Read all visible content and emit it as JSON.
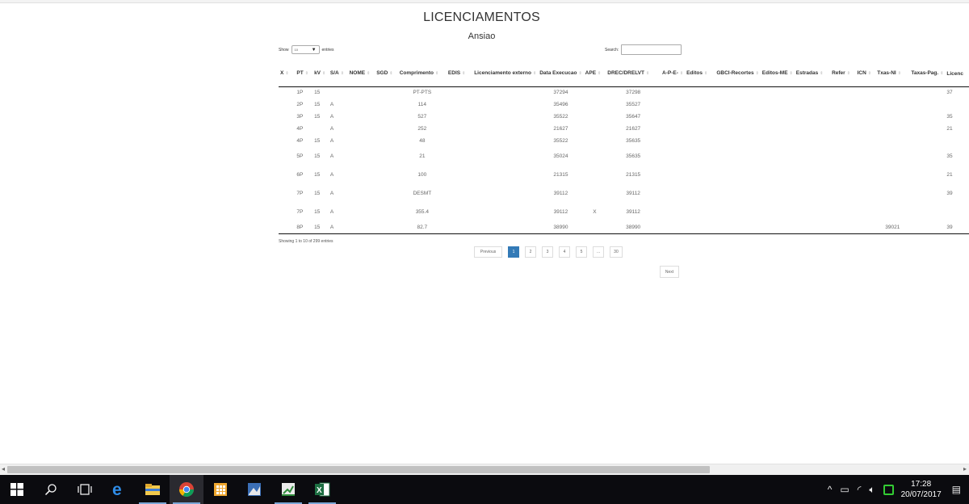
{
  "page": {
    "title": "LICENCIAMENTOS",
    "subtitle": "Ansiao"
  },
  "controls": {
    "show_label": "Show",
    "length_value": "10",
    "entries_label": "entries",
    "search_label": "Search:",
    "search_value": ""
  },
  "table": {
    "headers": [
      "X",
      "PT",
      "kV",
      "S/A",
      "NOME",
      "SGD",
      "Comprimento",
      "EDIS",
      "Licenciamento externo",
      "Data Execucao",
      "APE",
      "DREC/DRELVT",
      "A-P-E-",
      "Editos",
      "GBCI-Recortes",
      "Editos-ME",
      "Estradas",
      "Refer",
      "ICN",
      "Txas-NI",
      "Taxas-Pag.",
      "Licenc"
    ],
    "rows": [
      [
        "",
        "1P",
        "15",
        "",
        "",
        "",
        "PT-PTS",
        "",
        "",
        "37294",
        "",
        "37298",
        "",
        "",
        "",
        "",
        "",
        "",
        "",
        "",
        "",
        "37"
      ],
      [
        "",
        "2P",
        "15",
        "A",
        "",
        "",
        "114",
        "",
        "",
        "35496",
        "",
        "35527",
        "",
        "",
        "",
        "",
        "",
        "",
        "",
        "",
        "",
        ""
      ],
      [
        "",
        "3P",
        "15",
        "A",
        "",
        "",
        "527",
        "",
        "",
        "35522",
        "",
        "35647",
        "",
        "",
        "",
        "",
        "",
        "",
        "",
        "",
        "",
        "35"
      ],
      [
        "",
        "4P",
        "",
        "A",
        "",
        "",
        "252",
        "",
        "",
        "21627",
        "",
        "21627",
        "",
        "",
        "",
        "",
        "",
        "",
        "",
        "",
        "",
        "21"
      ],
      [
        "",
        "4P",
        "15",
        "A",
        "",
        "",
        "48",
        "",
        "",
        "35522",
        "",
        "35635",
        "",
        "",
        "",
        "",
        "",
        "",
        "",
        "",
        "",
        ""
      ],
      [
        "",
        "5P",
        "15",
        "A",
        "",
        "",
        "21",
        "",
        "",
        "35024",
        "",
        "35635",
        "",
        "",
        "",
        "",
        "",
        "",
        "",
        "",
        "",
        "35"
      ],
      [
        "",
        "6P",
        "15",
        "A",
        "",
        "",
        "100",
        "",
        "",
        "21315",
        "",
        "21315",
        "",
        "",
        "",
        "",
        "",
        "",
        "",
        "",
        "",
        "21"
      ],
      [
        "",
        "7P",
        "15",
        "A",
        "",
        "",
        "DESMT",
        "",
        "",
        "39112",
        "",
        "39112",
        "",
        "",
        "",
        "",
        "",
        "",
        "",
        "",
        "",
        "39"
      ],
      [
        "",
        "7P",
        "15",
        "A",
        "",
        "",
        "355.4",
        "",
        "",
        "39112",
        "X",
        "39112",
        "",
        "",
        "",
        "",
        "",
        "",
        "",
        "",
        "",
        ""
      ],
      [
        "",
        "8P",
        "15",
        "A",
        "",
        "",
        "82.7",
        "",
        "",
        "38990",
        "",
        "38990",
        "",
        "",
        "",
        "",
        "",
        "",
        "",
        "39021",
        "",
        "39"
      ]
    ]
  },
  "pagination": {
    "info": "Showing 1 to 10 of 299 entries",
    "previous": "Previous",
    "pages": [
      "1",
      "2",
      "3",
      "4",
      "5",
      "...",
      "30"
    ],
    "active": "1",
    "next": "Next"
  },
  "taskbar": {
    "time": "17:28",
    "date": "20/07/2017"
  },
  "colors": {
    "accent": "#337ab7",
    "taskbar": "#0b0b0f"
  }
}
